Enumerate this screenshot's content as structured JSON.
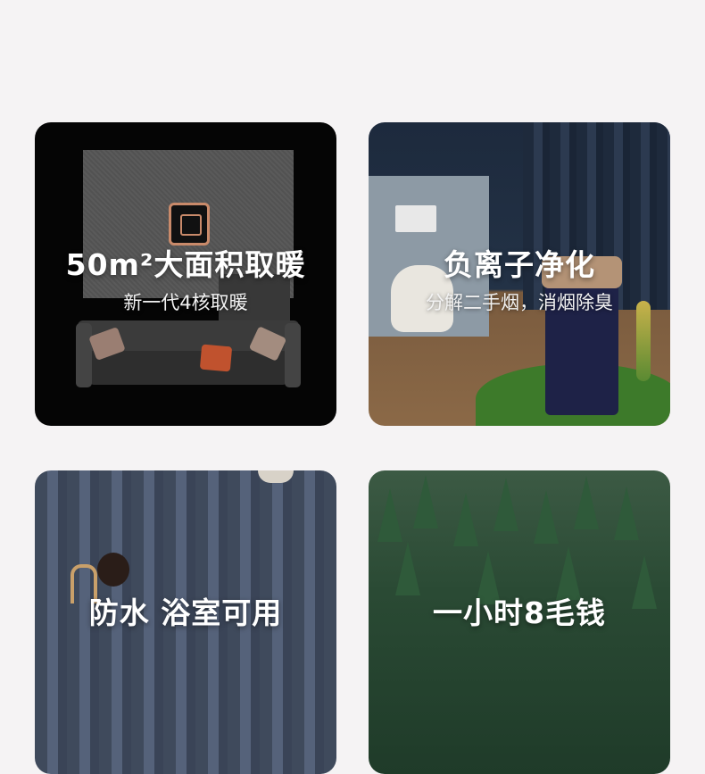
{
  "cards": [
    {
      "title": "50m²大面积取暖",
      "subtitle": "新一代4核取暖"
    },
    {
      "title": "负离子净化",
      "subtitle": "分解二手烟，消烟除臭"
    },
    {
      "title": "防水 浴室可用",
      "subtitle": ""
    },
    {
      "title": "一小时8毛钱",
      "subtitle": ""
    }
  ],
  "colors": {
    "page_background": "#f5f3f4",
    "text": "#ffffff"
  }
}
